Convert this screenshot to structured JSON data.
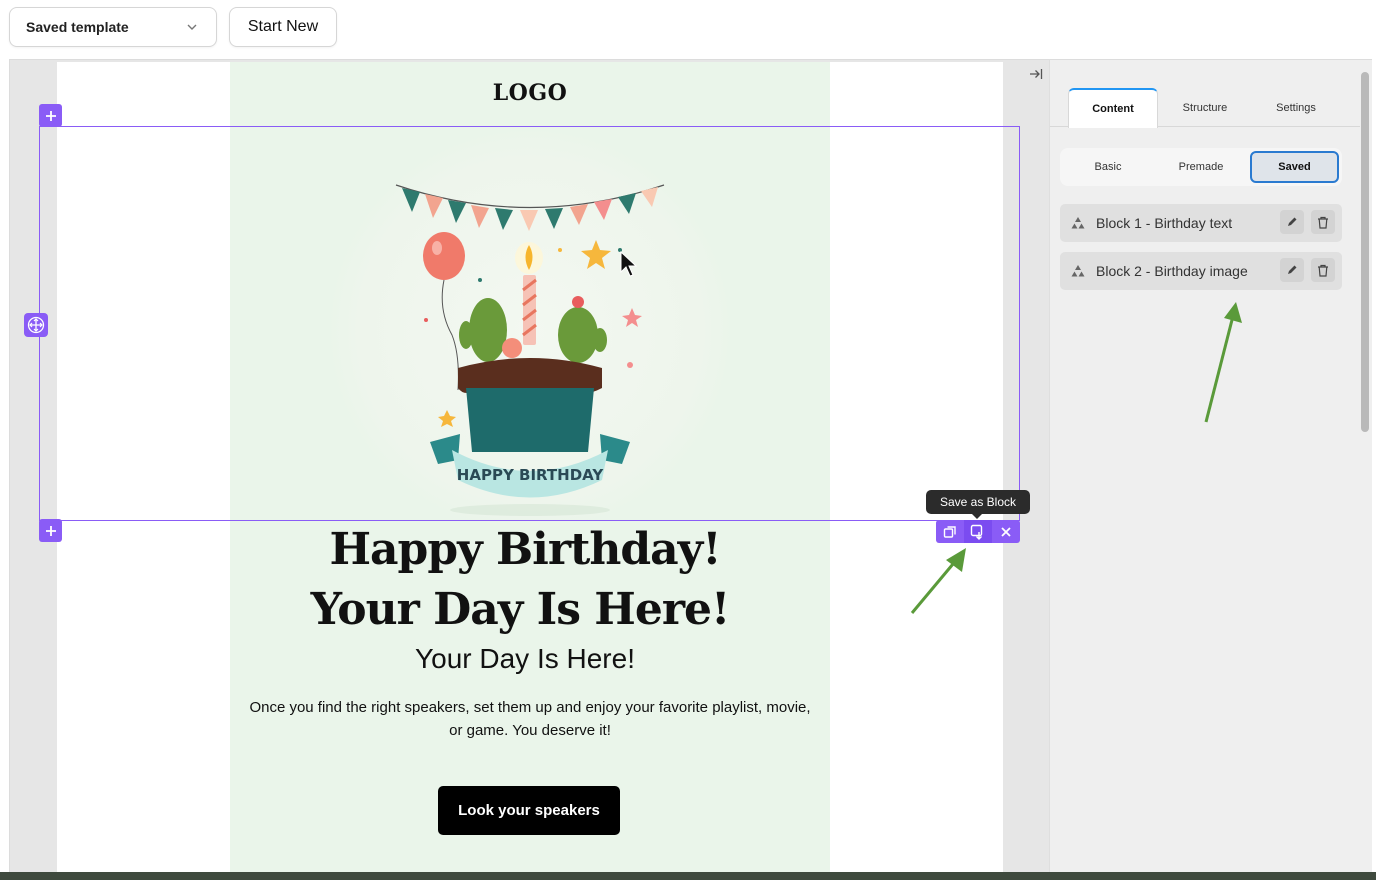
{
  "header": {
    "template_select": {
      "value": "Saved template",
      "icon": "chevron-down-icon"
    },
    "start_new_label": "Start New"
  },
  "email": {
    "logo_text": "LOGO",
    "image": {
      "banner_text": "HAPPY BIRTHDAY",
      "alt": "Happy Birthday cake illustration"
    },
    "heading_line1": "Happy Birthday!",
    "heading_line2": "Your Day Is Here!",
    "subheading": "Your Day Is Here!",
    "paragraph_line1": "Once you find the right speakers, set them up and enjoy your favorite playlist, movie,",
    "paragraph_line2": "or game. You deserve it!",
    "cta_label": "Look your speakers"
  },
  "selection_toolbar": {
    "tooltip": "Save as Block",
    "actions": [
      "duplicate-icon",
      "save-block-icon",
      "close-icon"
    ]
  },
  "panel": {
    "tabs": [
      {
        "label": "Content",
        "active": true
      },
      {
        "label": "Structure",
        "active": false
      },
      {
        "label": "Settings",
        "active": false
      }
    ],
    "subtabs": [
      {
        "label": "Basic",
        "active": false
      },
      {
        "label": "Premade",
        "active": false
      },
      {
        "label": "Saved",
        "active": true
      }
    ],
    "saved_blocks": [
      {
        "label": "Block 1 - Birthday text"
      },
      {
        "label": "Block 2 - Birthday image"
      }
    ]
  },
  "colors": {
    "accent": "#8a5cf6",
    "email_bg": "#eaf5ea",
    "tab_active": "#2196f3",
    "annotation_arrow": "#5a9a3a"
  }
}
